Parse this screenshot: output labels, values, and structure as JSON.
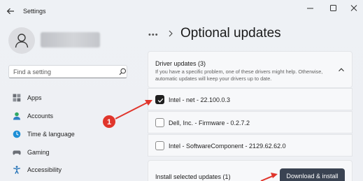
{
  "window": {
    "title": "Settings"
  },
  "sidebar": {
    "search_placeholder": "Find a setting",
    "items": [
      {
        "label": "Apps",
        "icon": "apps-icon"
      },
      {
        "label": "Accounts",
        "icon": "accounts-icon"
      },
      {
        "label": "Time & language",
        "icon": "time-language-icon"
      },
      {
        "label": "Gaming",
        "icon": "gaming-icon"
      },
      {
        "label": "Accessibility",
        "icon": "accessibility-icon"
      }
    ]
  },
  "main": {
    "breadcrumb_ellipsis": "•••",
    "title": "Optional updates",
    "driver_card": {
      "title": "Driver updates (3)",
      "description": "If you have a specific problem, one of these drivers might help. Otherwise, automatic updates will keep your drivers up to date."
    },
    "drivers": [
      {
        "name": "Intel - net - 22.100.0.3",
        "checked": true
      },
      {
        "name": "Dell, Inc. - Firmware - 0.2.7.2",
        "checked": false
      },
      {
        "name": "Intel - SoftwareComponent - 2129.62.62.0",
        "checked": false
      }
    ],
    "install": {
      "label": "Install selected updates (1)",
      "button": "Download & install"
    }
  },
  "annotation": {
    "step": "1",
    "color": "#e0352b"
  },
  "colors": {
    "accent_button": "#3a4352",
    "checkbox_checked": "#1f1f1f"
  }
}
